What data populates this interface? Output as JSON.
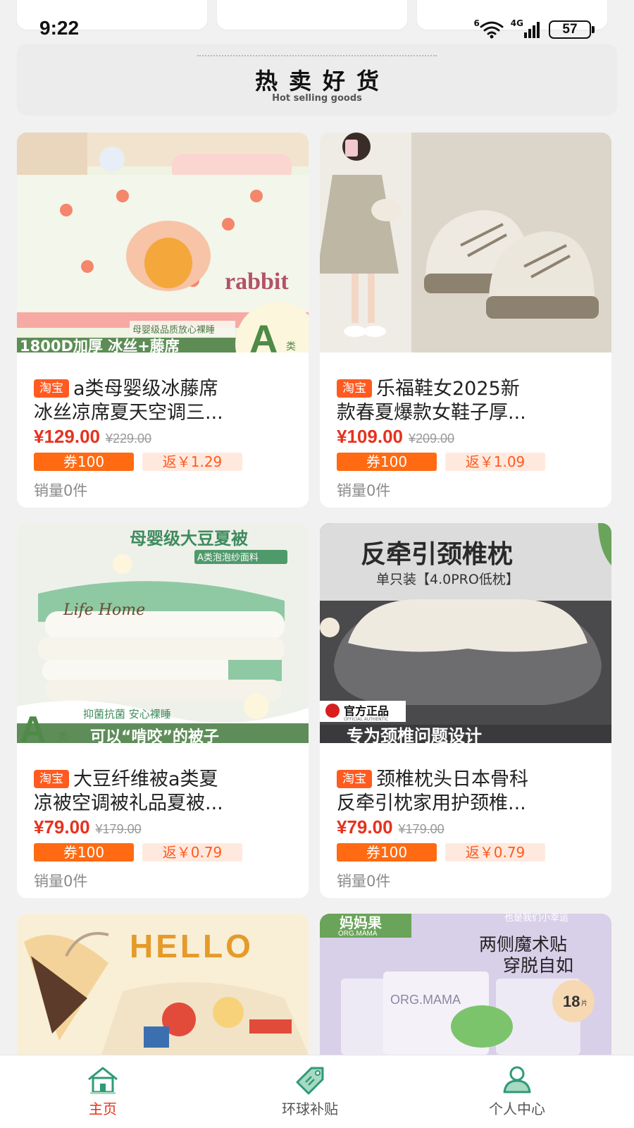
{
  "status_bar": {
    "time": "9:22",
    "wifi_label": "6",
    "signal_label": "4G",
    "battery": "57"
  },
  "section": {
    "title": "热卖好货",
    "subtitle": "Hot selling goods"
  },
  "products": [
    {
      "badge": "淘宝",
      "title_line1": "a类母婴级冰藤席",
      "title_line2": "冰丝凉席夏天空调三...",
      "price": "¥129.00",
      "original_price": "¥229.00",
      "coupon": "券100",
      "rebate": "返￥1.29",
      "sales": "销量0件",
      "image_text": [
        "母婴级品质放心裸睡",
        "1800D加厚 冰丝+藤席",
        "A",
        "类",
        "rabbit"
      ]
    },
    {
      "badge": "淘宝",
      "title_line1": "乐福鞋女2025新",
      "title_line2": "款春夏爆款女鞋子厚...",
      "price": "¥109.00",
      "original_price": "¥209.00",
      "coupon": "券100",
      "rebate": "返￥1.09",
      "sales": "销量0件",
      "image_text": []
    },
    {
      "badge": "淘宝",
      "title_line1": "大豆纤维被a类夏",
      "title_line2": "凉被空调被礼品夏被...",
      "price": "¥79.00",
      "original_price": "¥179.00",
      "coupon": "券100",
      "rebate": "返￥0.79",
      "sales": "销量0件",
      "image_text": [
        "母婴级大豆夏被",
        "A类泡泡纱面料",
        "Life Home",
        "抑菌抗菌 安心裸睡",
        "可以“啃咬”的被子",
        "A",
        "类"
      ]
    },
    {
      "badge": "淘宝",
      "title_line1": "颈椎枕头日本骨科",
      "title_line2": "反牵引枕家用护颈椎...",
      "price": "¥79.00",
      "original_price": "¥179.00",
      "coupon": "券100",
      "rebate": "返￥0.79",
      "sales": "销量0件",
      "image_text": [
        "反牵引颈椎枕",
        "单只装【4.0PRO低枕】",
        "官方正品",
        "OFFICIAL AUTHENTIC",
        "专为颈椎问题设计"
      ]
    },
    {
      "image_text": [
        "HELLO"
      ]
    },
    {
      "image_text": [
        "妈妈果",
        "ORG.MAMA",
        "也是我们小幸运",
        "两侧魔术贴",
        "穿脱自如",
        "ORG.MAMA",
        "18",
        "片"
      ]
    }
  ],
  "bottom_nav": [
    {
      "label": "主页",
      "icon": "home-icon",
      "active": true
    },
    {
      "label": "环球补贴",
      "icon": "price-tag-icon",
      "active": false
    },
    {
      "label": "个人中心",
      "icon": "user-icon",
      "active": false
    }
  ],
  "colors": {
    "accent": "#e6321e",
    "coupon": "#ff6a12",
    "nav_icon": "#2f9a78"
  }
}
